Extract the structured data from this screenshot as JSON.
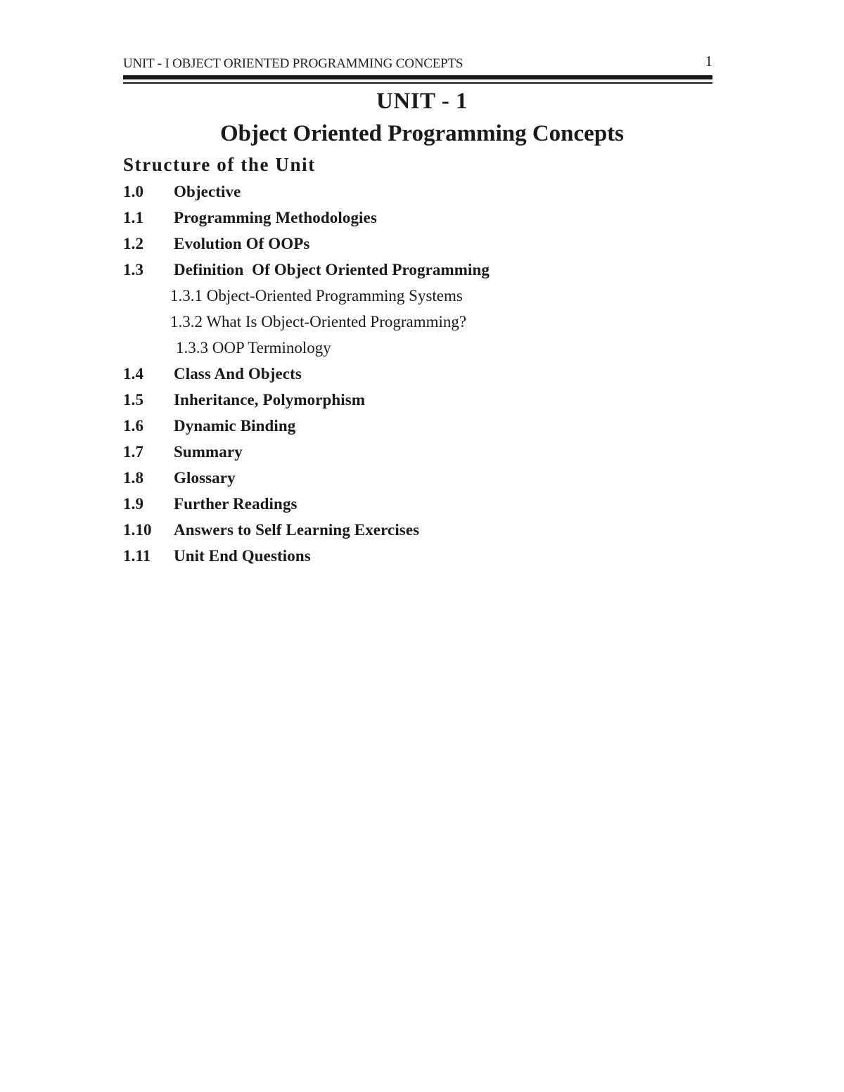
{
  "document": {
    "page_number": "1",
    "running_header": "UNIT - I OBJECT ORIENTED PROGRAMMING CONCEPTS",
    "unit_title": "UNIT - 1",
    "unit_subtitle": "Object Oriented Programming Concepts",
    "structure_heading": "Structure of the Unit"
  },
  "toc": {
    "items": [
      {
        "level": 1,
        "number": "1.0",
        "label": "Objective"
      },
      {
        "level": 1,
        "number": "1.1",
        "label": "Programming Methodologies"
      },
      {
        "level": 1,
        "number": "1.2",
        "label": "Evolution Of OOPs"
      },
      {
        "level": 1,
        "number": "1.3",
        "label": "Definition  Of Object Oriented Programming"
      },
      {
        "level": 2,
        "number": "1.3.1",
        "label": "1.3.1 Object-Oriented Programming Systems"
      },
      {
        "level": 2,
        "number": "1.3.2",
        "label": "1.3.2 What Is Object-Oriented Programming?"
      },
      {
        "level": 2,
        "number": "1.3.3",
        "label": "1.3.3 OOP Terminology",
        "extra_indent": true
      },
      {
        "level": 1,
        "number": "1.4",
        "label": "Class And Objects"
      },
      {
        "level": 1,
        "number": "1.5",
        "label": "Inheritance, Polymorphism"
      },
      {
        "level": 1,
        "number": "1.6",
        "label": "Dynamic Binding"
      },
      {
        "level": 1,
        "number": "1.7",
        "label": "Summary"
      },
      {
        "level": 1,
        "number": "1.8",
        "label": "Glossary"
      },
      {
        "level": 1,
        "number": "1.9",
        "label": "Further Readings"
      },
      {
        "level": 1,
        "number": "1.10",
        "label": "Answers to Self Learning Exercises"
      },
      {
        "level": 1,
        "number": "1.11",
        "label": "Unit End Questions"
      }
    ]
  },
  "colors": {
    "text": "#1a1a1a",
    "rule": "#181818",
    "background": "#ffffff"
  }
}
